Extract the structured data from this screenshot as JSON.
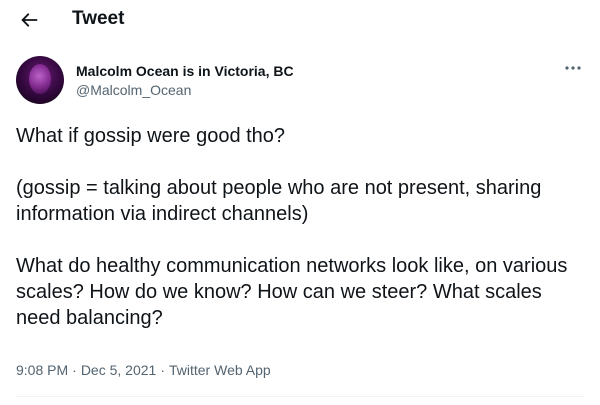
{
  "header": {
    "title": "Tweet",
    "back_icon": "arrow-left-icon"
  },
  "author": {
    "name": "Malcolm Ocean is in Victoria, BC",
    "handle": "@Malcolm_Ocean",
    "more_icon": "more-horizontal-icon"
  },
  "tweet": {
    "paragraphs": [
      "What if gossip were good tho?",
      "(gossip = talking about people who are not present, sharing information via indirect channels)",
      "What do healthy communication networks look like, on various scales? How do we know? How can we steer? What scales need balancing?"
    ],
    "time": "9:08 PM",
    "date": "Dec 5, 2021",
    "source": "Twitter Web App",
    "separator": "·"
  }
}
